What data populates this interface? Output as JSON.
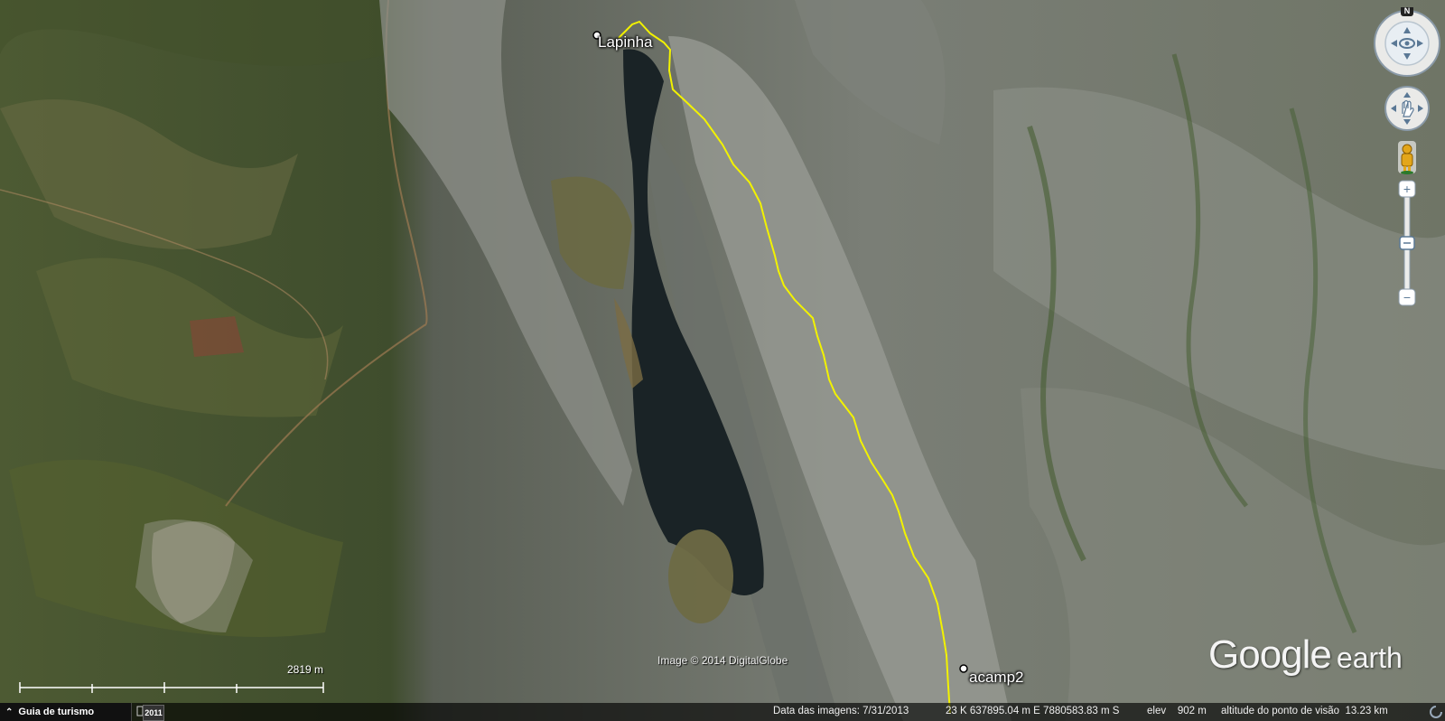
{
  "map": {
    "places": [
      {
        "id": "lapinha",
        "name": "Lapinha"
      },
      {
        "id": "acamp2",
        "name": "acamp2"
      }
    ],
    "track_color": "#f2f200",
    "imagery_credit": "Image © 2014 DigitalGlobe",
    "logo": {
      "word1": "Google",
      "word2": "earth"
    },
    "scale_label": "2819 m"
  },
  "navigation": {
    "compass_north": "N",
    "zoom_plus": "+",
    "zoom_minus": "−"
  },
  "statusbar": {
    "tour_button": "Guia de turismo",
    "history_year": "2011",
    "image_date": "Data das imagens: 7/31/2013",
    "coordinates": "23 K 637895.04 m E 7880583.83 m S",
    "elevation": "elev    902 m",
    "eye_altitude": "altitude do ponto de visão  13.23 km"
  },
  "colors": {
    "lake": "#1a2326",
    "track": "#f2f200",
    "rock": "#8a8e86",
    "vegetation": "#4a5a2e"
  }
}
